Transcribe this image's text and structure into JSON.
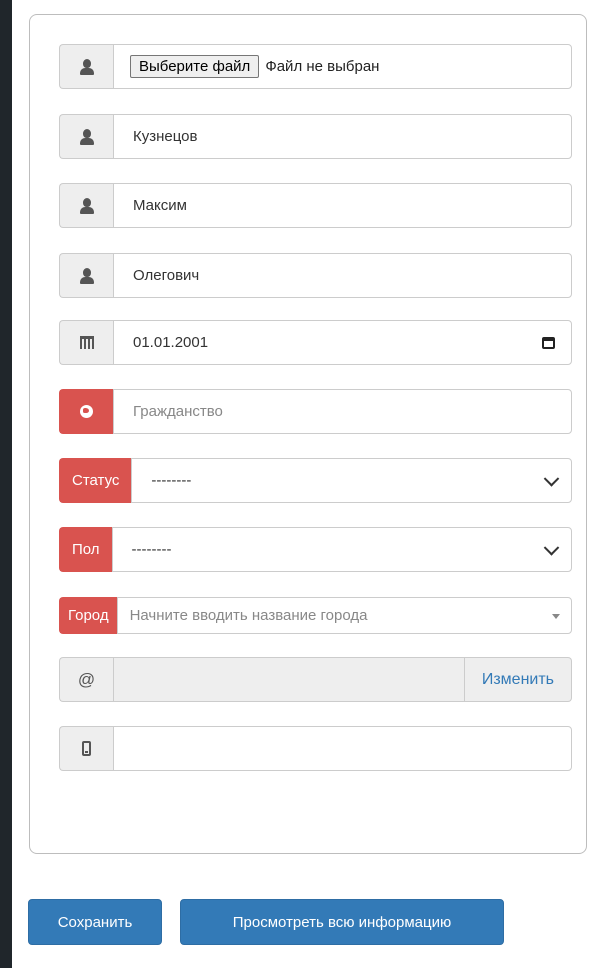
{
  "form": {
    "photo": {
      "button_label": "Выберите файл",
      "status_text": "Файл не выбран",
      "icon": "user-icon"
    },
    "last_name": {
      "value": "Кузнецов",
      "icon": "user-icon"
    },
    "first_name": {
      "value": "Максим",
      "icon": "user-icon"
    },
    "middle_name": {
      "value": "Олегович",
      "icon": "user-icon"
    },
    "birth_date": {
      "value": "01.01.2001",
      "icon": "calendar-icon"
    },
    "citizenship": {
      "placeholder": "Гражданство",
      "icon": "globe-icon"
    },
    "status": {
      "label": "Статус",
      "selected": "--------"
    },
    "gender": {
      "label": "Пол",
      "selected": "--------"
    },
    "city": {
      "label": "Город",
      "placeholder": "Начните вводить название города"
    },
    "email": {
      "icon_text": "@",
      "value": "",
      "change_label": "Изменить"
    },
    "phone": {
      "value": "",
      "icon": "mobile-phone-icon"
    }
  },
  "actions": {
    "save_label": "Сохранить",
    "view_all_label": "Просмотреть всю информацию"
  },
  "colors": {
    "primary": "#337ab7",
    "danger": "#d9534f",
    "addon_bg": "#eeeeee",
    "page_bg": "#20262b"
  }
}
